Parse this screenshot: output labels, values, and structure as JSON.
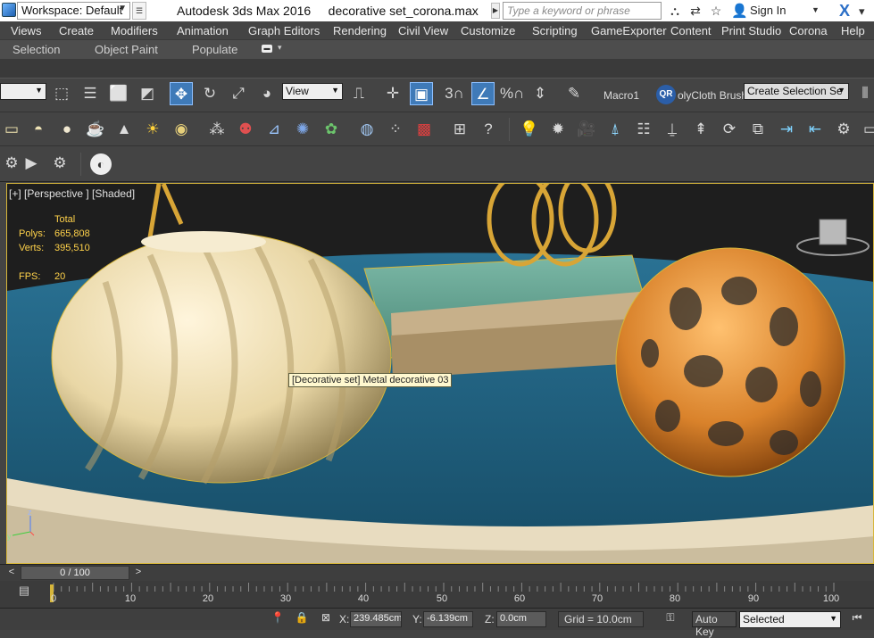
{
  "titlebar": {
    "workspace": "Workspace: Default",
    "app_title": "Autodesk 3ds Max 2016     decorative set_corona.max",
    "search_placeholder": "Type a keyword or phrase",
    "sign_in": "Sign In",
    "icons": [
      "binoculars-icon",
      "exchange-icon",
      "star-icon",
      "user-icon",
      "exchange-x-icon",
      "help-icon"
    ]
  },
  "menu": [
    "Views",
    "Create",
    "Modifiers",
    "Animation",
    "Graph Editors",
    "Rendering",
    "Civil View",
    "Customize",
    "Scripting",
    "GameExporter",
    "Content",
    "Print Studio",
    "Corona",
    "Help"
  ],
  "ribbon_tabs": [
    "Selection",
    "Object Paint",
    "Populate"
  ],
  "toolbar": {
    "view_dropdown": "View",
    "macro_label": "Macro1",
    "polycloth_label": "olyCloth Brushe",
    "selection_set": "Create Selection Se",
    "snap_3": "3",
    "percent_label": "%"
  },
  "viewport": {
    "label": "[+] [Perspective ] [Shaded]",
    "stats": {
      "header": "Total",
      "polys_label": "Polys:",
      "polys_value": "665,808",
      "verts_label": "Verts:",
      "verts_value": "395,510",
      "fps_label": "FPS:",
      "fps_value": "20"
    },
    "tooltip": "[Decorative set] Metal decorative 03",
    "colors": {
      "frame": "#d7b63a",
      "tray": "#1f5f7d",
      "cream": "#e9d7a6",
      "orange": "#d9822b",
      "book": "#5f9e8e",
      "gold": "#d8a536"
    }
  },
  "timeline": {
    "slider": "0 / 100",
    "ticks": [
      "0",
      "10",
      "20",
      "30",
      "40",
      "50",
      "60",
      "70",
      "80",
      "90",
      "100"
    ]
  },
  "status": {
    "x_label": "X:",
    "x_value": "239.485cm",
    "y_label": "Y:",
    "y_value": "-6.139cm",
    "z_label": "Z:",
    "z_value": "0.0cm",
    "grid": "Grid = 10.0cm",
    "autokey": "Auto Key",
    "selected": "Selected"
  }
}
